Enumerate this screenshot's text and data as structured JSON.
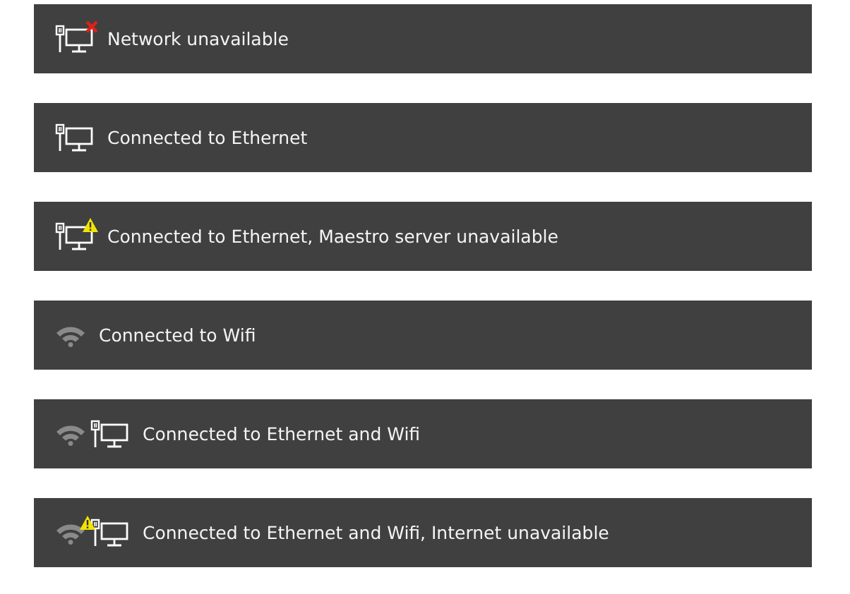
{
  "notifications": [
    {
      "text": "Network unavailable",
      "wifi": false,
      "ethernet": true,
      "error": true,
      "warning": false
    },
    {
      "text": "Connected to Ethernet",
      "wifi": false,
      "ethernet": true,
      "error": false,
      "warning": false
    },
    {
      "text": "Connected to Ethernet, Maestro server unavailable",
      "wifi": false,
      "ethernet": true,
      "error": false,
      "warning": true
    },
    {
      "text": "Connected to Wifi",
      "wifi": true,
      "ethernet": false,
      "error": false,
      "warning": false
    },
    {
      "text": "Connected to Ethernet and Wifi",
      "wifi": true,
      "ethernet": true,
      "error": false,
      "warning": false
    },
    {
      "text": "Connected to Ethernet and Wifi, Internet unavailable",
      "wifi": true,
      "ethernet": true,
      "error": false,
      "warning": true
    }
  ]
}
